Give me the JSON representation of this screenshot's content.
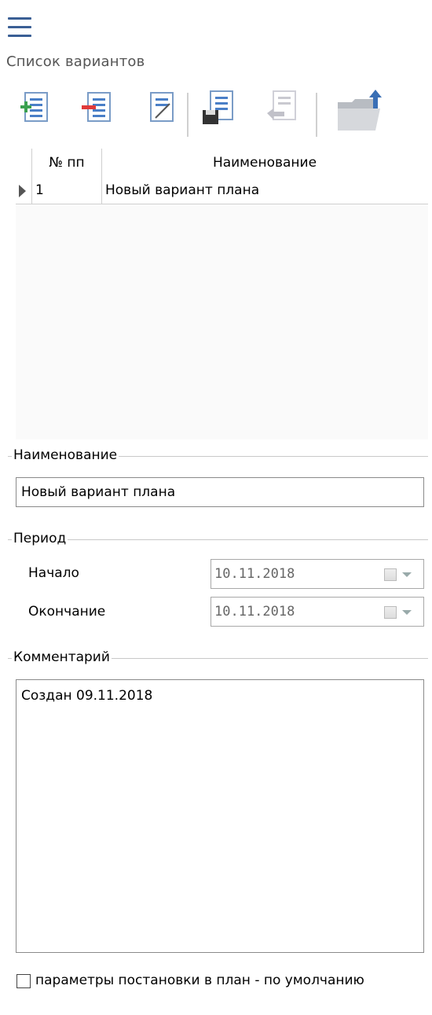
{
  "header": {
    "menu_icon": "hamburger-menu-icon",
    "title": "Список вариантов"
  },
  "toolbar": {
    "buttons": [
      {
        "name": "add-variant",
        "icon": "add-document-icon"
      },
      {
        "name": "delete-variant",
        "icon": "remove-document-icon"
      },
      {
        "name": "edit-variant",
        "icon": "edit-document-icon"
      },
      {
        "name": "save-variant",
        "icon": "save-document-icon"
      },
      {
        "name": "undo-variant",
        "icon": "undo-document-icon"
      },
      {
        "name": "open-folder",
        "icon": "folder-upload-icon"
      }
    ]
  },
  "grid": {
    "columns": [
      "№ пп",
      "Наименование"
    ],
    "rows": [
      {
        "num": "1",
        "name": "Новый вариант плана"
      }
    ]
  },
  "details": {
    "name_group_label": "Наименование",
    "name_value": "Новый вариант плана",
    "period_group_label": "Период",
    "start_label": "Начало",
    "start_value": "10.11.2018",
    "end_label": "Окончание",
    "end_value": "10.11.2018",
    "comment_group_label": "Комментарий",
    "comment_value": "Создан 09.11.2018"
  },
  "footer": {
    "checkbox_label": "параметры постановки в план - по умолчанию",
    "checkbox_checked": false
  },
  "colors": {
    "accent": "#3a5f95",
    "add_green": "#3aa050",
    "remove_red": "#e03a3a",
    "doc_blue": "#4a7fc7"
  }
}
